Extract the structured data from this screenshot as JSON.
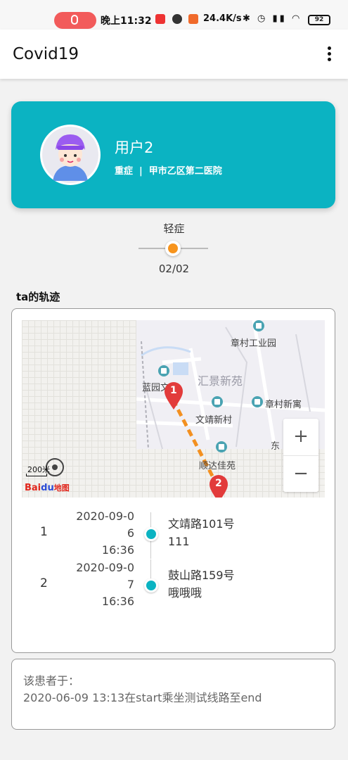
{
  "status_bar": {
    "time": "晚上11:32",
    "net_speed": "24.4K/s",
    "battery": "92"
  },
  "app_bar": {
    "title": "Covid19",
    "menu_icon": "more-vertical-icon"
  },
  "profile": {
    "name": "用户2",
    "severity": "重症",
    "separator": "|",
    "hospital": "甲市乙区第二医院",
    "card_color": "#0bb3c2"
  },
  "severity_slider": {
    "label": "轻症",
    "page": "02/02",
    "thumb_color": "#f7941d"
  },
  "track": {
    "title": "ta的轨迹",
    "map": {
      "labels": {
        "zhangcun_park": "章村工业园",
        "huijing": "汇景新苑",
        "lanyuan": "蓝园文路",
        "zhangcun_xinyu": "章村新寓",
        "wenjing": "文靖新村",
        "dong": "东",
        "shunda": "顺达佳苑"
      },
      "marker_1": "1",
      "marker_2": "2",
      "zoom_in": "+",
      "zoom_out": "−",
      "scale": "200米",
      "logo_text": "Bai",
      "logo_paw": "du",
      "logo_cn": "地图",
      "route_color": "#f39020",
      "marker_color": "#e23b3b"
    },
    "timeline": [
      {
        "index": "1",
        "date_1": "2020-09-0",
        "date_2": "6",
        "date_3": "16:36",
        "address": "文靖路101号",
        "note": "111"
      },
      {
        "index": "2",
        "date_1": "2020-09-0",
        "date_2": "7",
        "date_3": "16:36",
        "address": "鼓山路159号",
        "note": "哦哦哦"
      }
    ]
  },
  "note": {
    "title": "该患者于：",
    "body": "2020-06-09 13:13在start乘坐测试线路至end"
  }
}
